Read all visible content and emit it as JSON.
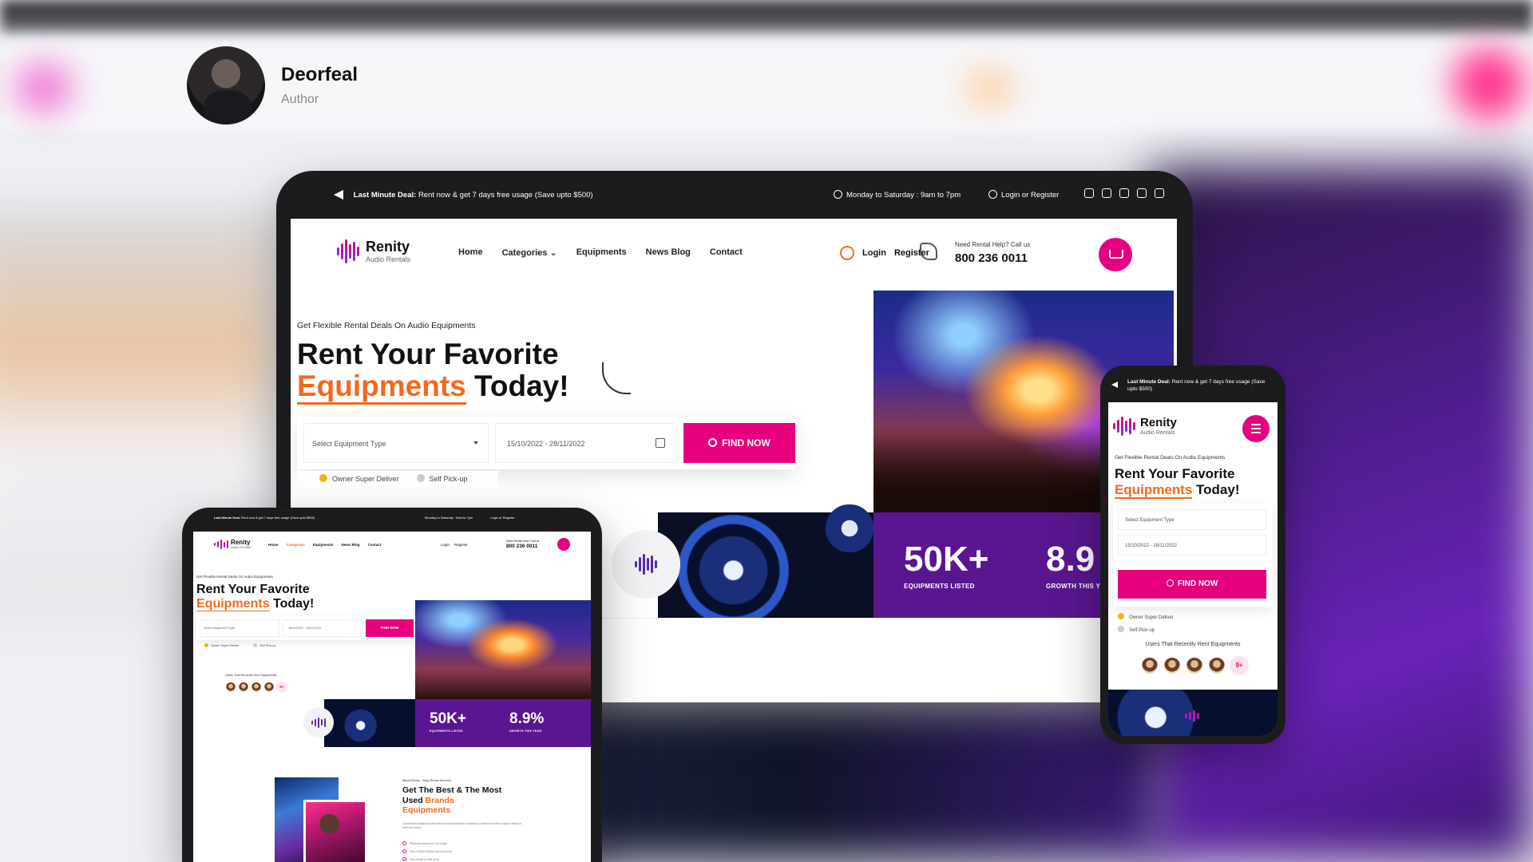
{
  "author": {
    "name": "Deorfeal",
    "role": "Author"
  },
  "brand": {
    "name": "Renity",
    "tagline": "Audio Rentals",
    "pink": "#e6007e",
    "orange": "#f26a1b",
    "purple": "#5a1690",
    "dark": "#1c1c1f"
  },
  "topbar": {
    "deal_label": "Last Minute Deal:",
    "deal_text": "Rent now & get 7 days free usage (Save upto $500)",
    "hours": "Monday to Saturday :  9am to 7pm",
    "login_register": "Login or Register",
    "socials": [
      "facebook-icon",
      "twitter-icon",
      "instagram-icon",
      "youtube-icon",
      "mail-icon"
    ]
  },
  "nav": {
    "items": [
      "Home",
      "Categories",
      "Equipments",
      "News Blog",
      "Contact"
    ],
    "active": "Categories",
    "login": "Login",
    "register": "Register",
    "help_label": "Need Rental Help? Call us",
    "help_number": "800 236 0011"
  },
  "hero": {
    "subtitle": "Get Flexible Rental Deals On Audio Equipments",
    "title_line1": "Rent Your Favorite",
    "title_highlight": "Equipments",
    "title_end": "Today!",
    "select_placeholder": "Select Equipment Type",
    "date_range": "15/10/2022 - 28/11/2022",
    "find_button": "FIND NOW",
    "radio_owner": "Owner Super Deliver",
    "radio_self": "Self Pick-up"
  },
  "stats": [
    {
      "value": "50K+",
      "label": "EQUIPMENTS LISTED"
    },
    {
      "value": "8.9%",
      "label": "GROWTH THIS YEAR"
    }
  ],
  "stats_visible": {
    "laptop_value": "8.9",
    "laptop_label": "GROWTH THIS YE"
  },
  "users": {
    "label": "Users That Recently Rent Equipments",
    "more": "9+"
  },
  "about": {
    "subtitle": "About Renity - Easy Rental Services",
    "title_line1": "Get The Best & The Most",
    "title_line2_start": "Used",
    "title_brands": "Brands",
    "title_equipments": "Equipments",
    "text": "Consectetur adipiscing elit sed do eiusmod tempor incididunt ut labore et dolore magna aliqua ut enim ad minim.",
    "bullets": [
      "Pleasant experience on rental",
      "Rent a demo before you buy to try",
      "Free rental on first order"
    ]
  }
}
